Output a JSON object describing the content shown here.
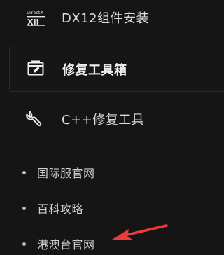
{
  "menu": {
    "items": [
      {
        "label": "DX12组件安装",
        "icon": "directx-xii-logo",
        "badge_top": "DirectX",
        "badge_bottom": "XII"
      },
      {
        "label": "修复工具箱",
        "icon": "toolbox-icon",
        "active": true
      },
      {
        "label": "C++修复工具",
        "icon": "wrench-icon"
      }
    ]
  },
  "links": [
    {
      "label": "国际服官网"
    },
    {
      "label": "百科攻略"
    },
    {
      "label": "港澳台官网"
    }
  ],
  "annotation": {
    "arrow_color": "#ef3b3b"
  }
}
